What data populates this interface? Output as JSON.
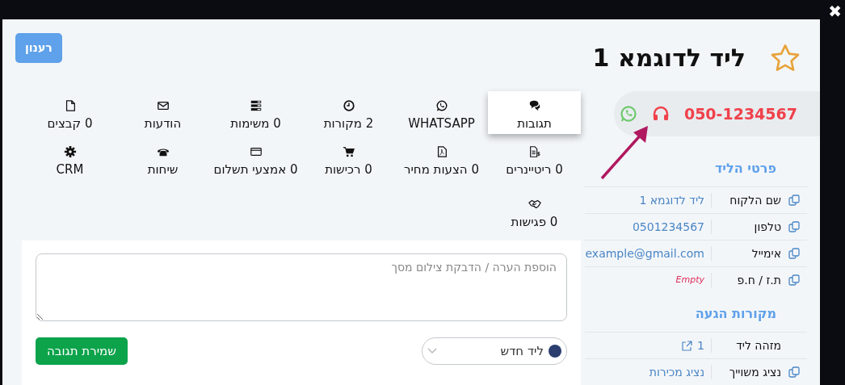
{
  "close_label": "✖",
  "modal": {
    "title": "ליד לדוגמא 1",
    "starred": false,
    "refresh_button": "רענון",
    "phone": "050-1234567",
    "tabs": [
      {
        "label": "תגובות",
        "selected": true
      },
      {
        "label": "WHATSAPP",
        "selected": false
      },
      {
        "label": "2 מקורות",
        "selected": false
      },
      {
        "label": "0 משימות",
        "selected": false
      },
      {
        "label": "הודעות",
        "selected": false
      },
      {
        "label": "0 קבצים",
        "selected": false
      },
      {
        "label": "0 ריטיינרים",
        "selected": false
      },
      {
        "label": "0 הצעות מחיר",
        "selected": false
      },
      {
        "label": "0 רכישות",
        "selected": false
      },
      {
        "label": "0 אמצעי תשלום",
        "selected": false
      },
      {
        "label": "שיחות",
        "selected": false
      },
      {
        "label": "CRM",
        "selected": false
      },
      {
        "label": "0 פגישות",
        "selected": false
      }
    ],
    "comment": {
      "placeholder": "הוספת הערה / הדבקת צילום מסך",
      "status": "ליד חדש",
      "save_button": "שמירת תגובה"
    },
    "sections": [
      {
        "title": "פרטי הליד",
        "rows": [
          {
            "label": "שם הלקוח",
            "value": "ליד לדוגמא 1",
            "kind": "copy"
          },
          {
            "label": "טלפון",
            "value": "0501234567",
            "kind": "copy"
          },
          {
            "label": "אימייל",
            "value": "example@gmail.com",
            "kind": "copy"
          },
          {
            "label": "ת.ז / ח.פ",
            "value": "Empty",
            "kind": "empty"
          }
        ]
      },
      {
        "title": "מקורות הגעה",
        "rows": [
          {
            "label": "מזהה ליד",
            "value": "1",
            "kind": "link"
          },
          {
            "label": "נציג משוייך",
            "value": "נציג מכירות",
            "kind": "copy"
          }
        ]
      }
    ]
  }
}
